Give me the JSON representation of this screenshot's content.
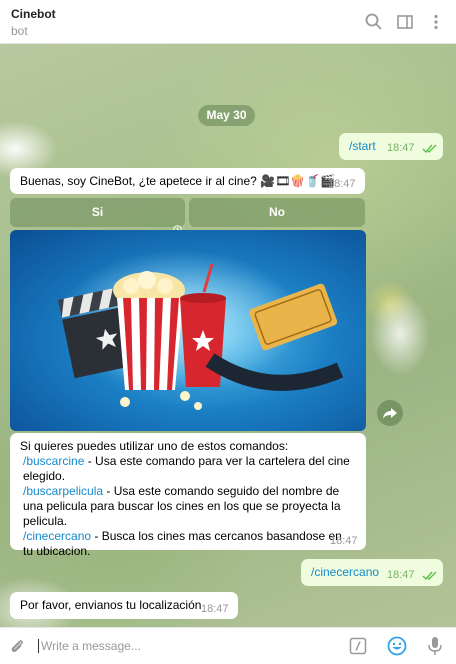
{
  "header": {
    "title": "Cinebot",
    "subtitle": "bot",
    "icons": [
      "search-icon",
      "sidebar-toggle-icon",
      "more-vert-icon"
    ]
  },
  "chat": {
    "date": "May 30",
    "messages": [
      {
        "direction": "out",
        "text": "/start",
        "time": "18:47",
        "read": true
      },
      {
        "direction": "in",
        "text": "Buenas, soy CineBot, ¿te apetece ir al cine? 🎥🎞🍿🥤🎬",
        "time": "18:47"
      },
      {
        "direction": "in",
        "kind": "photo",
        "description_icon": "cinema-photo"
      },
      {
        "direction": "in",
        "intro": "Si quieres puedes utilizar uno de estos comandos:",
        "commands": [
          {
            "cmd": "/buscarcine",
            "desc": " - Usa este comando para ver la cartelera del cine elegido."
          },
          {
            "cmd": "/buscarpelicula",
            "desc": " - Usa este comando seguido del nombre de una pelicula para buscar los cines en los que se proyecta la pelicula."
          },
          {
            "cmd": "/cinecercano",
            "desc": " - Busca los cines mas cercanos basandose en tu ubicacion."
          }
        ],
        "time": "18:47"
      },
      {
        "direction": "out",
        "text": "/cinecercano",
        "time": "18:47",
        "read": true
      },
      {
        "direction": "in",
        "text": "Por favor, envianos tu localización",
        "time": "18:47"
      }
    ],
    "keyboard": [
      {
        "label": "Si"
      },
      {
        "label": "No"
      }
    ]
  },
  "composer": {
    "placeholder": "Write a message...",
    "icons": [
      "attach-icon",
      "bot-command-icon",
      "emoji-icon",
      "microphone-icon"
    ]
  },
  "colors": {
    "outgoing_bubble": "#effdde",
    "incoming_bubble": "#ffffff",
    "link": "#168acd",
    "check": "#5dbf4f"
  }
}
